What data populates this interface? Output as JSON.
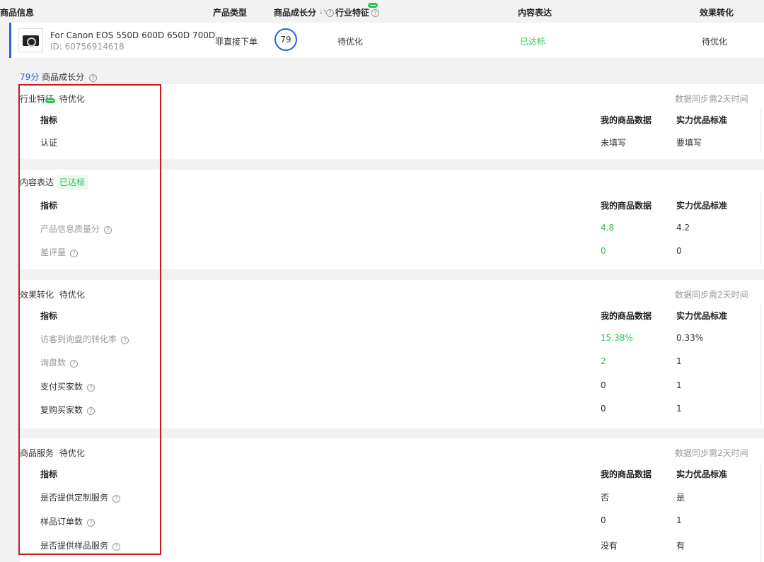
{
  "table_header": {
    "product_info": "商品信息",
    "product_type": "产品类型",
    "growth_score": "商品成长分",
    "industry_feature": "行业特征",
    "content_expression": "内容表达",
    "effect_conversion": "效果转化"
  },
  "product": {
    "title": "For Canon EOS 550D 600D 650D 700D...",
    "id": "ID: 60756914618",
    "type": "非直接下单",
    "score": "79",
    "industry_status": "待优化",
    "content_status": "已达标",
    "effect_status": "待优化"
  },
  "score_line": {
    "value": "79分",
    "label": "商品成长分"
  },
  "common": {
    "col_indicator": "指标",
    "col_mine": "我的商品数据",
    "col_standard": "实力优品标准",
    "sync_note": "数据同步需2天时间"
  },
  "sections": {
    "industry": {
      "title": "行业特征",
      "status": "待优化",
      "rows": [
        {
          "label": "认证",
          "mine": "未填写",
          "std": "要填写"
        }
      ]
    },
    "content": {
      "title": "内容表达",
      "status": "已达标",
      "rows": [
        {
          "label": "产品信息质量分",
          "mine": "4.8",
          "std": "4.2"
        },
        {
          "label": "差评量",
          "mine": "0",
          "std": "0"
        }
      ]
    },
    "effect": {
      "title": "效果转化",
      "status": "待优化",
      "rows": [
        {
          "label": "访客到询盘的转化率",
          "mine": "15.38%",
          "std": "0.33%"
        },
        {
          "label": "询盘数",
          "mine": "2",
          "std": "1"
        },
        {
          "label": "支付买家数",
          "mine": "0",
          "std": "1"
        },
        {
          "label": "复购买家数",
          "mine": "0",
          "std": "1"
        }
      ]
    },
    "service": {
      "title": "商品服务",
      "status": "待优化",
      "rows": [
        {
          "label": "是否提供定制服务",
          "mine": "否",
          "std": "是"
        },
        {
          "label": "样品订单数",
          "mine": "0",
          "std": "1"
        },
        {
          "label": "是否提供样品服务",
          "mine": "没有",
          "std": "有"
        }
      ]
    }
  },
  "icons": {
    "help": "question-circle-icon",
    "sort": "sort-arrows-icon",
    "new": "new-badge-icon"
  },
  "colors": {
    "accent": "#3360d6",
    "success": "#2fc25b",
    "highlight": "#c81b1b"
  }
}
